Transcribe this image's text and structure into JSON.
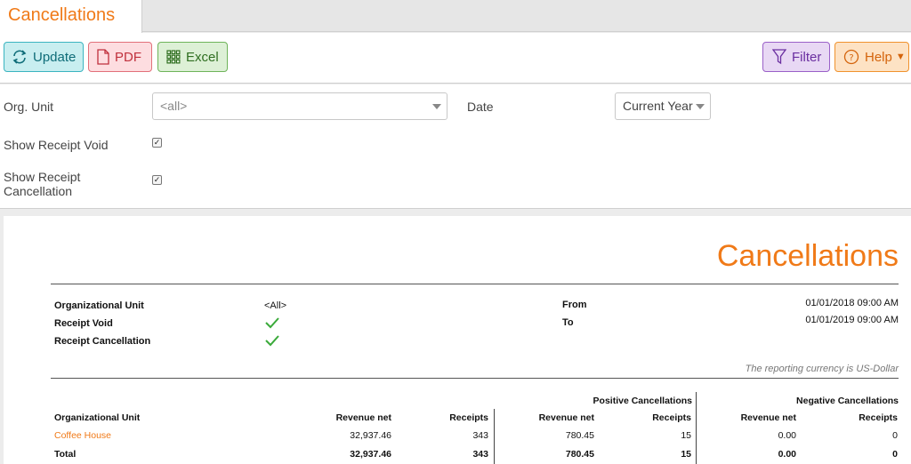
{
  "tab": {
    "title": "Cancellations"
  },
  "toolbar": {
    "update_label": "Update",
    "pdf_label": "PDF",
    "excel_label": "Excel",
    "filter_label": "Filter",
    "help_label": "Help"
  },
  "filters": {
    "org_unit_label": "Org. Unit",
    "org_unit_value": "<all>",
    "date_label": "Date",
    "date_value": "Current Year",
    "show_receipt_void_label": "Show Receipt Void",
    "show_receipt_void_checked": true,
    "show_receipt_cancellation_label": "Show Receipt Cancellation",
    "show_receipt_cancellation_checked": true
  },
  "report": {
    "title": "Cancellations",
    "meta": {
      "org_unit_label": "Organizational Unit",
      "org_unit_value": "<All>",
      "receipt_void_label": "Receipt Void",
      "receipt_cancellation_label": "Receipt Cancellation",
      "from_label": "From",
      "from_value": "01/01/2018 09:00 AM",
      "to_label": "To",
      "to_value": "01/01/2019 09:00 AM"
    },
    "currency_note": "The reporting currency is US-Dollar",
    "table": {
      "group_headers": {
        "positive": "Positive Cancellations",
        "negative": "Negative Cancellations"
      },
      "columns": [
        "Organizational Unit",
        "Revenue net",
        "Receipts",
        "Revenue net",
        "Receipts",
        "Revenue net",
        "Receipts"
      ],
      "rows": [
        {
          "unit": "Coffee House",
          "rev": "32,937.46",
          "rec": "343",
          "pos_rev": "780.45",
          "pos_rec": "15",
          "neg_rev": "0.00",
          "neg_rec": "0"
        }
      ],
      "total": {
        "unit": "Total",
        "rev": "32,937.46",
        "rec": "343",
        "pos_rev": "780.45",
        "pos_rec": "15",
        "neg_rev": "0.00",
        "neg_rec": "0"
      }
    }
  }
}
